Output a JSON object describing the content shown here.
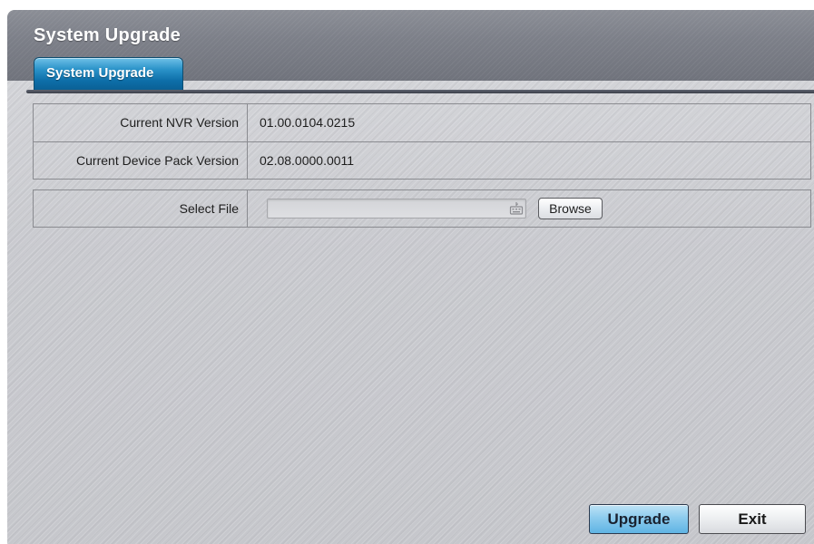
{
  "window": {
    "title": "System Upgrade"
  },
  "tabs": [
    {
      "label": "System Upgrade",
      "active": true
    }
  ],
  "info": {
    "rows": [
      {
        "label": "Current NVR Version",
        "value": "01.00.0104.0215"
      },
      {
        "label": "Current Device Pack Version",
        "value": "02.08.0000.0011"
      }
    ]
  },
  "file": {
    "label": "Select File",
    "value": "",
    "keyboard_icon": "keyboard-icon",
    "browse_label": "Browse"
  },
  "actions": {
    "upgrade_label": "Upgrade",
    "exit_label": "Exit"
  },
  "colors": {
    "accent": "#1a7fbc",
    "upgrade_button": "#8dccee",
    "title_bar": "#7d8089"
  }
}
